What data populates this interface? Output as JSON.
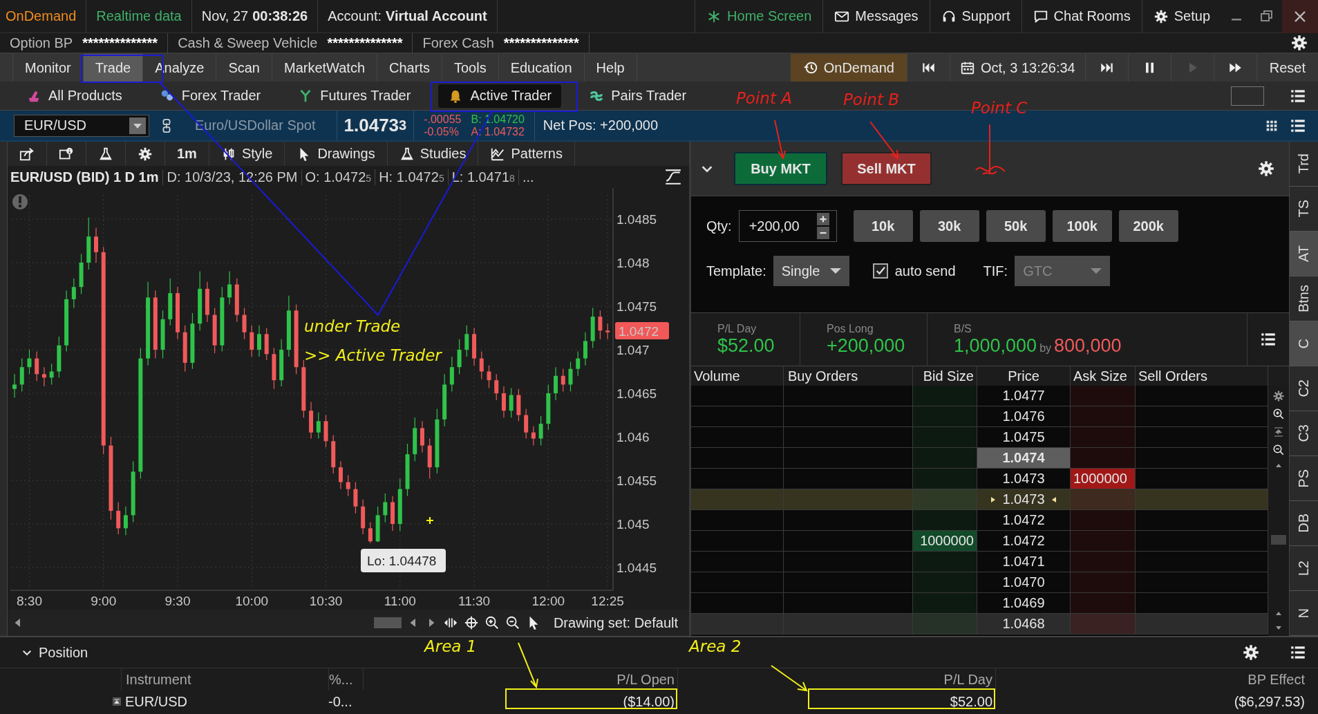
{
  "header": {
    "brand": "OnDemand",
    "status": "Realtime data",
    "date": "Nov, 27",
    "time": "00:38:26",
    "account_label": "Account:",
    "account": "Virtual Account",
    "links": [
      {
        "label": "Home Screen",
        "kind": "home"
      },
      {
        "label": "Messages",
        "kind": "mail"
      },
      {
        "label": "Support",
        "kind": "headset"
      },
      {
        "label": "Chat Rooms",
        "kind": "chat"
      },
      {
        "label": "Setup",
        "kind": "gear"
      }
    ]
  },
  "balances": [
    {
      "label": "Option BP",
      "value": "**************"
    },
    {
      "label": "Cash & Sweep Vehicle",
      "value": "**************"
    },
    {
      "label": "Forex Cash",
      "value": "**************"
    }
  ],
  "main_tabs": [
    {
      "label": "Monitor",
      "selected": false
    },
    {
      "label": "Trade",
      "selected": true
    },
    {
      "label": "Analyze",
      "selected": false
    },
    {
      "label": "Scan",
      "selected": false
    },
    {
      "label": "MarketWatch",
      "selected": false
    },
    {
      "label": "Charts",
      "selected": false
    },
    {
      "label": "Tools",
      "selected": false
    },
    {
      "label": "Education",
      "selected": false
    },
    {
      "label": "Help",
      "selected": false
    }
  ],
  "ondemand": {
    "label": "OnDemand",
    "datetime": "Oct, 3 13:26:34",
    "reset": "Reset"
  },
  "sub_tabs": [
    {
      "label": "All Products",
      "kind": "all",
      "selected": false
    },
    {
      "label": "Forex Trader",
      "kind": "forex",
      "selected": false
    },
    {
      "label": "Futures Trader",
      "kind": "futures",
      "selected": false
    },
    {
      "label": "Active Trader",
      "kind": "active",
      "selected": true
    },
    {
      "label": "Pairs Trader",
      "kind": "pairs",
      "selected": false
    }
  ],
  "symbol_bar": {
    "symbol": "EUR/USD",
    "description": "Euro/USDollar Spot",
    "last": "1.0473",
    "last_small": "3",
    "change": "-.00055",
    "change_pct": "-0.05%",
    "bid": "B: 1.04720",
    "ask": "A: 1.04732",
    "net_pos": "Net Pos: +200,000"
  },
  "chart_toolbar": [
    {
      "kind": "share"
    },
    {
      "kind": "info"
    },
    {
      "kind": "flask"
    },
    {
      "kind": "gear"
    },
    {
      "kind": "plain",
      "label": "1m"
    },
    {
      "kind": "candle",
      "label": "Style"
    },
    {
      "kind": "cursor",
      "label": "Drawings"
    },
    {
      "kind": "flask",
      "label": "Studies"
    },
    {
      "kind": "patterns",
      "label": "Patterns"
    }
  ],
  "chart": {
    "title": "EUR/USD (BID) 1 D 1m",
    "fields": [
      {
        "text": "D: 10/3/23, 12:26 PM"
      },
      {
        "text": "O: 1.0472",
        "small": "5"
      },
      {
        "text": "H: 1.0472",
        "small": "5"
      },
      {
        "text": "L: 1.0471",
        "small": "8"
      },
      {
        "text": "..."
      }
    ],
    "chart_data": {
      "type": "candlestick",
      "grid": true,
      "ylim": [
        1.044238,
        1.048857
      ],
      "categories": [
        null,
        null,
        "8:30",
        null,
        null,
        null,
        null,
        null,
        null,
        null,
        null,
        null,
        "9:00",
        null,
        null,
        null,
        null,
        null,
        null,
        null,
        null,
        null,
        "9:30",
        null,
        null,
        null,
        null,
        null,
        null,
        null,
        null,
        null,
        "10:00",
        null,
        null,
        null,
        null,
        null,
        null,
        null,
        null,
        null,
        "10:30",
        null,
        null,
        null,
        null,
        null,
        null,
        null,
        null,
        null,
        "11:00",
        null,
        null,
        null,
        null,
        null,
        null,
        null,
        null,
        null,
        "11:30",
        null,
        null,
        null,
        null,
        null,
        null,
        null,
        null,
        null,
        "12:00",
        null,
        null,
        null,
        null,
        null,
        null,
        null,
        "12:25"
      ],
      "yticks": [
        {
          "value": 1.0485,
          "label": "1.0485"
        },
        {
          "value": 1.048,
          "label": "1.048"
        },
        {
          "value": 1.0475,
          "label": "1.0475"
        },
        {
          "value": 1.047,
          "label": "1.047"
        },
        {
          "value": 1.0465,
          "label": "1.0465"
        },
        {
          "value": 1.046,
          "label": "1.046"
        },
        {
          "value": 1.0455,
          "label": "1.0455"
        },
        {
          "value": 1.045,
          "label": "1.045"
        },
        {
          "value": 1.0445,
          "label": "1.0445"
        }
      ],
      "ohlc": [
        [
          1.04655,
          1.04672,
          1.04645,
          1.0466
        ],
        [
          1.0466,
          1.0469,
          1.04652,
          1.0468
        ],
        [
          1.0468,
          1.047,
          1.04672,
          1.0469
        ],
        [
          1.0469,
          1.04698,
          1.04664,
          1.04672
        ],
        [
          1.04672,
          1.0468,
          1.04658,
          1.04668
        ],
        [
          1.04668,
          1.04684,
          1.0466,
          1.04675
        ],
        [
          1.04675,
          1.04715,
          1.04668,
          1.04705
        ],
        [
          1.04705,
          1.04768,
          1.04698,
          1.04758
        ],
        [
          1.04758,
          1.04782,
          1.04748,
          1.04772
        ],
        [
          1.04772,
          1.0481,
          1.04764,
          1.048
        ],
        [
          1.048,
          1.04852,
          1.04792,
          1.0483
        ],
        [
          1.0483,
          1.0484,
          1.048,
          1.04812
        ],
        [
          1.04812,
          1.04818,
          1.0458,
          1.0459
        ],
        [
          1.0459,
          1.046,
          1.04505,
          1.04515
        ],
        [
          1.04515,
          1.04525,
          1.04488,
          1.04495
        ],
        [
          1.04495,
          1.0452,
          1.04487,
          1.0451
        ],
        [
          1.0451,
          1.04572,
          1.04502,
          1.0456
        ],
        [
          1.0456,
          1.04702,
          1.04552,
          1.0469
        ],
        [
          1.0469,
          1.04778,
          1.04682,
          1.0476
        ],
        [
          1.0476,
          1.04768,
          1.0469,
          1.047
        ],
        [
          1.047,
          1.04745,
          1.0469,
          1.04735
        ],
        [
          1.04735,
          1.04782,
          1.04728,
          1.04765
        ],
        [
          1.04765,
          1.04772,
          1.04712,
          1.0472
        ],
        [
          1.0472,
          1.04728,
          1.04675,
          1.04685
        ],
        [
          1.04685,
          1.04742,
          1.04678,
          1.0473
        ],
        [
          1.0473,
          1.0479,
          1.04722,
          1.0477
        ],
        [
          1.0477,
          1.04778,
          1.04732,
          1.0474
        ],
        [
          1.0474,
          1.04748,
          1.04696,
          1.04705
        ],
        [
          1.04705,
          1.04772,
          1.04698,
          1.0476
        ],
        [
          1.0476,
          1.0479,
          1.04752,
          1.04775
        ],
        [
          1.04775,
          1.04782,
          1.04732,
          1.0474
        ],
        [
          1.0474,
          1.04748,
          1.04712,
          1.0472
        ],
        [
          1.0472,
          1.04728,
          1.04692,
          1.047
        ],
        [
          1.047,
          1.04728,
          1.04692,
          1.04718
        ],
        [
          1.04718,
          1.04725,
          1.04688,
          1.04695
        ],
        [
          1.04695,
          1.04702,
          1.04655,
          1.04665
        ],
        [
          1.04665,
          1.04712,
          1.04658,
          1.047
        ],
        [
          1.047,
          1.04762,
          1.04692,
          1.04745
        ],
        [
          1.04745,
          1.04752,
          1.04672,
          1.0468
        ],
        [
          1.0468,
          1.04688,
          1.04622,
          1.0463
        ],
        [
          1.0463,
          1.0464,
          1.04598,
          1.04605
        ],
        [
          1.04605,
          1.04628,
          1.04598,
          1.04618
        ],
        [
          1.04618,
          1.04625,
          1.04588,
          1.04595
        ],
        [
          1.04595,
          1.04602,
          1.04558,
          1.04565
        ],
        [
          1.04565,
          1.04572,
          1.0454,
          1.04548
        ],
        [
          1.04548,
          1.04556,
          1.04532,
          1.0454
        ],
        [
          1.0454,
          1.04548,
          1.04512,
          1.0452
        ],
        [
          1.0452,
          1.04528,
          1.04488,
          1.04495
        ],
        [
          1.04495,
          1.04502,
          1.04478,
          1.0448
        ],
        [
          1.0448,
          1.0452,
          1.04479,
          1.0451
        ],
        [
          1.0451,
          1.04535,
          1.04502,
          1.04525
        ],
        [
          1.04525,
          1.04532,
          1.04492,
          1.045
        ],
        [
          1.045,
          1.04552,
          1.04492,
          1.0454
        ],
        [
          1.0454,
          1.04592,
          1.04532,
          1.0458
        ],
        [
          1.0458,
          1.04622,
          1.04572,
          1.0461
        ],
        [
          1.0461,
          1.04618,
          1.04582,
          1.0459
        ],
        [
          1.0459,
          1.04598,
          1.04552,
          1.04565
        ],
        [
          1.04565,
          1.04632,
          1.04558,
          1.0462
        ],
        [
          1.0462,
          1.04672,
          1.04612,
          1.0466
        ],
        [
          1.0466,
          1.04692,
          1.04652,
          1.0468
        ],
        [
          1.0468,
          1.04712,
          1.04672,
          1.047
        ],
        [
          1.047,
          1.04728,
          1.04692,
          1.04718
        ],
        [
          1.04718,
          1.04725,
          1.04682,
          1.0469
        ],
        [
          1.0469,
          1.04698,
          1.04666,
          1.04675
        ],
        [
          1.04675,
          1.04682,
          1.04656,
          1.04665
        ],
        [
          1.04665,
          1.04672,
          1.04642,
          1.0465
        ],
        [
          1.0465,
          1.04658,
          1.04622,
          1.0463
        ],
        [
          1.0463,
          1.04656,
          1.04622,
          1.04648
        ],
        [
          1.04648,
          1.04655,
          1.04618,
          1.04625
        ],
        [
          1.04625,
          1.04632,
          1.04598,
          1.04605
        ],
        [
          1.04605,
          1.04612,
          1.0459,
          1.04598
        ],
        [
          1.04598,
          1.04624,
          1.0459,
          1.04615
        ],
        [
          1.04615,
          1.0466,
          1.04608,
          1.0465
        ],
        [
          1.0465,
          1.0468,
          1.04642,
          1.0467
        ],
        [
          1.0467,
          1.04678,
          1.04652,
          1.0466
        ],
        [
          1.0466,
          1.04686,
          1.04652,
          1.04678
        ],
        [
          1.04678,
          1.04698,
          1.0467,
          1.0469
        ],
        [
          1.0469,
          1.0472,
          1.04682,
          1.0471
        ],
        [
          1.0471,
          1.04748,
          1.04702,
          1.04738
        ],
        [
          1.04738,
          1.04745,
          1.04712,
          1.04722
        ],
        [
          1.04722,
          1.0473,
          1.04712,
          1.0472
        ]
      ]
    },
    "last_price": "1.0472",
    "low_label": "Lo: 1.04478",
    "drawing_set": "Drawing set: Default"
  },
  "order_bar": {
    "buy": "Buy MKT",
    "sell": "Sell MKT"
  },
  "qty": {
    "label": "Qty:",
    "value": "+200,00",
    "presets": [
      "10k",
      "30k",
      "50k",
      "100k",
      "200k"
    ]
  },
  "template": {
    "label": "Template:",
    "value": "Single",
    "auto_send": "auto send",
    "checked": true,
    "tif_label": "TIF:",
    "tif": "GTC",
    "tif_disabled": true
  },
  "stats": {
    "pl_day_label": "P/L Day",
    "pl_day": "$52.00",
    "pos_label": "Pos Long",
    "pos": "+200,000",
    "bs_label": "B/S",
    "buy": "1,000,000",
    "by": "by",
    "sell": "800,000"
  },
  "ladder": {
    "columns": [
      "Volume",
      "Buy Orders",
      "Bid Size",
      "Price",
      "Ask Size",
      "Sell Orders"
    ],
    "rows": [
      {
        "price": "1.0477",
        "kind": "normal"
      },
      {
        "price": "1.0476",
        "kind": "normal"
      },
      {
        "price": "1.0475",
        "kind": "normal"
      },
      {
        "price": "1.0474",
        "kind": "best"
      },
      {
        "price": "1.0473",
        "kind": "normal",
        "ask_size": "1000000"
      },
      {
        "price": "1.0473",
        "kind": "last"
      },
      {
        "price": "1.0472",
        "kind": "normal"
      },
      {
        "price": "1.0472",
        "kind": "normal",
        "bid_size": "1000000"
      },
      {
        "price": "1.0471",
        "kind": "normal"
      },
      {
        "price": "1.0470",
        "kind": "normal"
      },
      {
        "price": "1.0469",
        "kind": "normal"
      },
      {
        "price": "1.0468",
        "kind": "dim"
      }
    ]
  },
  "side_tabs": [
    {
      "label": "Trd",
      "selected": false
    },
    {
      "label": "TS",
      "selected": false
    },
    {
      "label": "AT",
      "selected": true
    },
    {
      "label": "Btns",
      "selected": false
    },
    {
      "label": "C",
      "selected": true
    },
    {
      "label": "C2",
      "selected": false
    },
    {
      "label": "C3",
      "selected": false
    },
    {
      "label": "PS",
      "selected": false
    },
    {
      "label": "DB",
      "selected": false
    },
    {
      "label": "L2",
      "selected": false
    },
    {
      "label": "N",
      "selected": false
    }
  ],
  "position": {
    "title": "Position",
    "columns": [
      "Instrument",
      "%...",
      "P/L Open",
      "P/L Day",
      "BP Effect"
    ],
    "rows": [
      [
        "EUR/USD",
        "-0...",
        "($14.00)",
        "$52.00",
        "($6,297.53)"
      ]
    ]
  },
  "annotations": [
    {
      "text": "Point A",
      "color": "#e8201c"
    },
    {
      "text": "Point B",
      "color": "#e8201c"
    },
    {
      "text": "Point C",
      "color": "#e8201c"
    },
    {
      "text": "under Trade",
      "color": "#f2ee1a"
    },
    {
      "text": ">> Active Trader",
      "color": "#f2ee1a"
    },
    {
      "text": "Area 1",
      "color": "#f2ee1a"
    },
    {
      "text": "Area 2",
      "color": "#f2ee1a"
    }
  ]
}
